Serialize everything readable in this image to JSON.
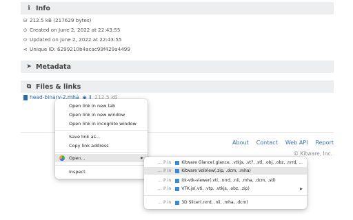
{
  "info": {
    "title": "Info",
    "size": "212.5 kB (217629 bytes)",
    "created": "Created on June 2, 2022 at 22:43:55",
    "updated": "Updated on June 2, 2022 at 22:43:55",
    "unique_id": "Unique ID: 6299210b4acac99f429a4499"
  },
  "metadata": {
    "title": "Metadata"
  },
  "files": {
    "title": "Files & links",
    "file_name": "head-binary-2.mha",
    "file_size": "212.5 kB"
  },
  "footer": {
    "links": [
      "About",
      "Contact",
      "Web API",
      "Report"
    ],
    "copyright": "© Kitware, Inc."
  },
  "context_menu": {
    "items": [
      "Open link in new tab",
      "Open link in new window",
      "Open link in incognito window",
      "Save link as...",
      "Copy link address",
      "Open...",
      "Inspect"
    ]
  },
  "submenu": {
    "prefix": "... ℙ in",
    "items": [
      "Kitware Glance(.glance, .vtkjs, .vt?, .stl, .obj, .obz, .nrrd, ...",
      "Kitware VolView(.zip, .dcm, .mha)",
      "itk-vtk-viewer(.vti, .nrrd, .nii, .mha, .dcm, .stl)",
      "VTK.js(.vti, .vtp, .vtkjs, .obz, .zip)",
      "3D Slicer(.nrrd, .nii, .mha, .dcm)"
    ]
  },
  "colors": {
    "accent": "#2b6aa6",
    "section_bg": "#eceef0"
  }
}
